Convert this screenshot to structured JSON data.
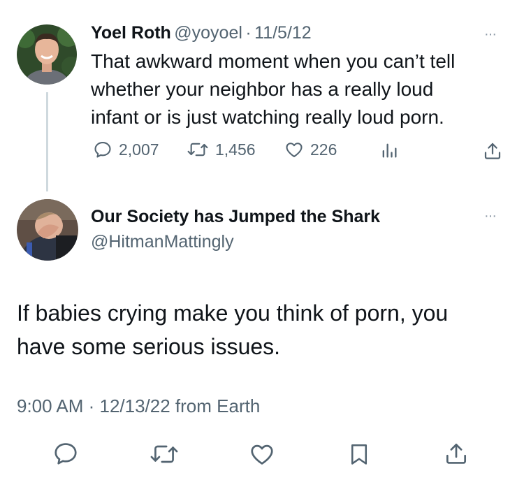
{
  "original_tweet": {
    "author_name": "Yoel Roth",
    "handle": "@yoyoel",
    "date": "11/5/12",
    "separator": "·",
    "text_lines": [
      "That awkward moment when you can’t tell",
      "whether your neighbor has a really loud",
      "infant or is just watching really loud porn."
    ],
    "replies": "2,007",
    "retweets": "1,456",
    "likes": "226"
  },
  "reply_tweet": {
    "author_name": "Our Society has Jumped the Shark",
    "handle": "@HitmanMattingly",
    "text_lines": [
      "If babies crying make you think of porn, you",
      "have some serious issues."
    ],
    "timestamp": "9:00 AM · 12/13/22 from Earth"
  },
  "more_glyph": "···",
  "colors": {
    "secondary_text": "#536471",
    "thread_line": "#cfd9de"
  }
}
